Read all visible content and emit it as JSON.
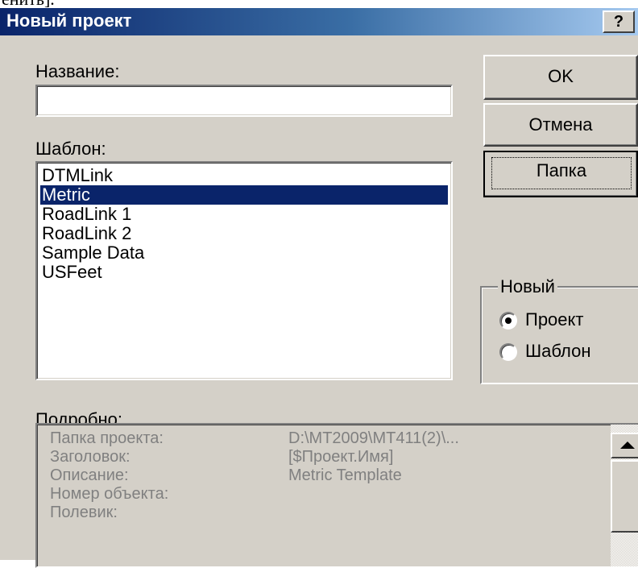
{
  "top_text": "енить].",
  "dialog": {
    "title": "Новый проект",
    "help_label": "?"
  },
  "name": {
    "label": "Название:",
    "value": ""
  },
  "template": {
    "label": "Шаблон:",
    "items": [
      "DTMLink",
      "Metric",
      "RoadLink 1",
      "RoadLink 2",
      "Sample Data",
      "USFeet"
    ],
    "selected": "Metric"
  },
  "buttons": {
    "ok": "OK",
    "cancel": "Отмена",
    "folder": "Папка"
  },
  "new_group": {
    "title": "Новый",
    "options": [
      "Проект",
      "Шаблон"
    ],
    "selected": "Проект"
  },
  "details": {
    "label": "Подробно:",
    "rows": [
      {
        "key": "Папка проекта:",
        "value": "D:\\MT2009\\MT411(2)\\..."
      },
      {
        "key": "Заголовок:",
        "value": "[$Проект.Имя]"
      },
      {
        "key": "Описание:",
        "value": "Metric Template"
      },
      {
        "key": "Номер объекта:",
        "value": ""
      },
      {
        "key": "Полевик:",
        "value": ""
      }
    ]
  },
  "colors": {
    "titlebar_start": "#0a246a",
    "titlebar_end": "#a6caf0",
    "selection": "#0a246a",
    "dialog_bg": "#d4d0c8",
    "disabled_text": "#808080"
  }
}
